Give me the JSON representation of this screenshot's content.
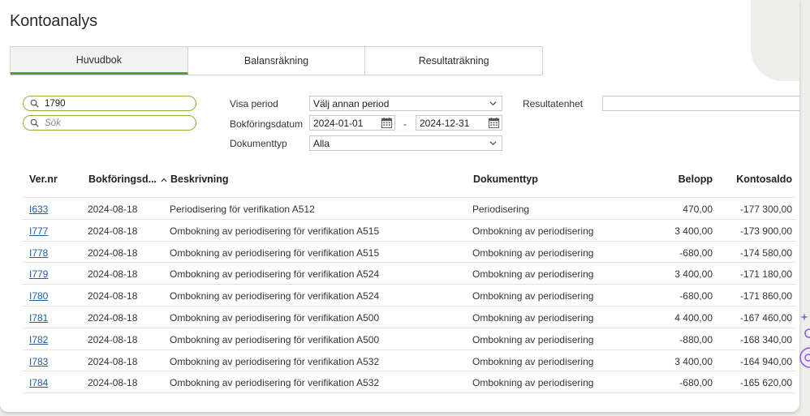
{
  "page": {
    "title": "Kontoanalys"
  },
  "tabs": [
    {
      "label": "Huvudbok",
      "active": true
    },
    {
      "label": "Balansräkning",
      "active": false
    },
    {
      "label": "Resultaträkning",
      "active": false
    }
  ],
  "filters": {
    "account_search_value": "1790",
    "search_placeholder": "Sök",
    "visa_period_label": "Visa period",
    "visa_period_value": "Välj annan period",
    "bokforingsdatum_label": "Bokföringsdatum",
    "date_from": "2024-01-01",
    "date_separator": "-",
    "date_to": "2024-12-31",
    "dokumenttyp_label": "Dokumenttyp",
    "dokumenttyp_value": "Alla",
    "resultatenhet_label": "Resultatenhet",
    "resultatenhet_value": ""
  },
  "table": {
    "columns": [
      "Ver.nr",
      "Bokföringsd...",
      "Beskrivning",
      "Dokumenttyp",
      "Belopp",
      "Kontosaldo"
    ],
    "rows": [
      {
        "ver": "I633",
        "date": "2024-08-18",
        "desc": "Periodisering för verifikation A512",
        "type": "Periodisering",
        "amount": "470,00",
        "balance": "-177 300,00"
      },
      {
        "ver": "I777",
        "date": "2024-08-18",
        "desc": "Ombokning av periodisering för verifikation A515",
        "type": "Ombokning av periodisering",
        "amount": "3 400,00",
        "balance": "-173 900,00"
      },
      {
        "ver": "I778",
        "date": "2024-08-18",
        "desc": "Ombokning av periodisering för verifikation A515",
        "type": "Ombokning av periodisering",
        "amount": "-680,00",
        "balance": "-174 580,00"
      },
      {
        "ver": "I779",
        "date": "2024-08-18",
        "desc": "Ombokning av periodisering för verifikation A524",
        "type": "Ombokning av periodisering",
        "amount": "3 400,00",
        "balance": "-171 180,00"
      },
      {
        "ver": "I780",
        "date": "2024-08-18",
        "desc": "Ombokning av periodisering för verifikation A524",
        "type": "Ombokning av periodisering",
        "amount": "-680,00",
        "balance": "-171 860,00"
      },
      {
        "ver": "I781",
        "date": "2024-08-18",
        "desc": "Ombokning av periodisering för verifikation A500",
        "type": "Ombokning av periodisering",
        "amount": "4 400,00",
        "balance": "-167 460,00"
      },
      {
        "ver": "I782",
        "date": "2024-08-18",
        "desc": "Ombokning av periodisering för verifikation A500",
        "type": "Ombokning av periodisering",
        "amount": "-880,00",
        "balance": "-168 340,00"
      },
      {
        "ver": "I783",
        "date": "2024-08-18",
        "desc": "Ombokning av periodisering för verifikation A532",
        "type": "Ombokning av periodisering",
        "amount": "3 400,00",
        "balance": "-164 940,00"
      },
      {
        "ver": "I784",
        "date": "2024-08-18",
        "desc": "Ombokning av periodisering för verifikation A532",
        "type": "Ombokning av periodisering",
        "amount": "-680,00",
        "balance": "-165 620,00"
      }
    ]
  },
  "colors": {
    "accent_green": "#5d9a26",
    "pill_border": "#8ab23e",
    "link_blue": "#1f5fa8",
    "widget_purple": "#8a5fd6"
  },
  "icons": [
    "search-icon",
    "chevron-down-icon",
    "calendar-icon",
    "sort-up-icon",
    "sparkle-icon",
    "assistant-icon"
  ]
}
